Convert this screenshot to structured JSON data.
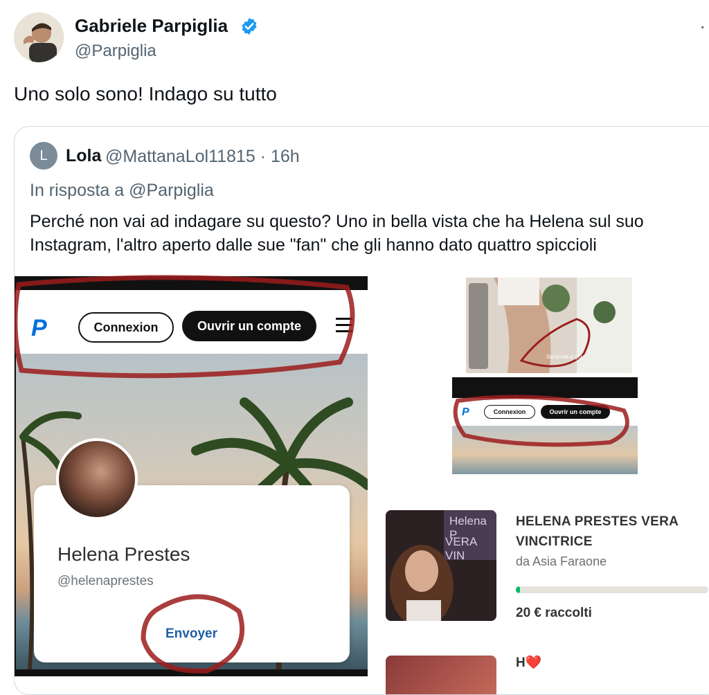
{
  "tweet": {
    "author_name": "Gabriele Parpiglia",
    "author_handle": "@Parpiglia",
    "more": "·",
    "text": "Uno solo sono! Indago su tutto"
  },
  "quoted": {
    "avatar_initial": "L",
    "name": "Lola",
    "handle_time": "@MattanaLol11815 · 16h",
    "reply_to": "In risposta a @Parpiglia",
    "text": "Perché non vai ad indagare su questo? Uno in bella vista che ha Helena sul suo Instagram, l'altro aperto dalle sue \"fan\" che gli hanno dato quattro spiccioli"
  },
  "paypal_shot": {
    "login_label": "Connexion",
    "signup_label": "Ouvrir un compte",
    "profile_name": "Helena Prestes",
    "profile_handle": "@helenaprestes",
    "send_label": "Envoyer"
  },
  "small_shot": {
    "gift_label": "Send me a gift"
  },
  "paypal_shot_small": {
    "login_label": "Connexion",
    "signup_label": "Ouvrir un compte"
  },
  "fundraiser": {
    "thumb_text_1": "Helena P",
    "thumb_text_2": "VERA VIN",
    "title": "HELENA PRESTES VERA VINCITRICE",
    "by": "da Asia Faraone",
    "progress": 0.02,
    "raised": "20 € raccolti"
  },
  "fundraiser_2": {
    "title": "H❤️"
  },
  "colors": {
    "verified": "#1d9bf0",
    "paypal_blue": "#0070e0",
    "annotation_red": "#9b1c1c",
    "progress_green": "#00b964"
  }
}
